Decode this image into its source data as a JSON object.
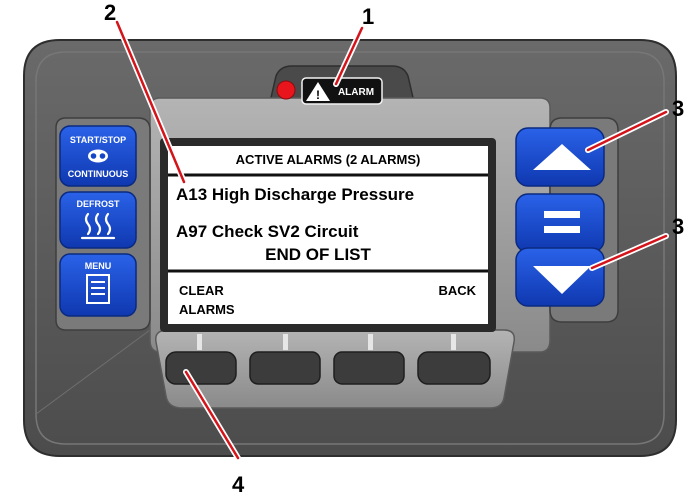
{
  "callouts": {
    "c1": "1",
    "c2": "2",
    "c3a": "3",
    "c3b": "3",
    "c4": "4"
  },
  "alarm_indicator": {
    "label": "ALARM"
  },
  "left_buttons": {
    "start_stop_label": "START/STOP",
    "continuous_label": "CONTINUOUS",
    "defrost_label": "DEFROST",
    "menu_label": "MENU"
  },
  "screen": {
    "header": "ACTIVE ALARMS (2 ALARMS)",
    "alarms": [
      "A13 High Discharge Pressure",
      "A97 Check SV2 Circuit"
    ],
    "end_of_list": "END OF LIST",
    "soft_key_left_line1": "CLEAR",
    "soft_key_left_line2": "ALARMS",
    "soft_key_right": "BACK"
  },
  "right_keys": [
    "up-arrow-icon",
    "select-icon",
    "down-arrow-icon"
  ],
  "colors": {
    "housing": "#5b5b5b",
    "bezel": "#9a9a9a",
    "key_blue": "#1446c8",
    "alarm_red": "#e8161c",
    "callout_red": "#d4141a"
  }
}
